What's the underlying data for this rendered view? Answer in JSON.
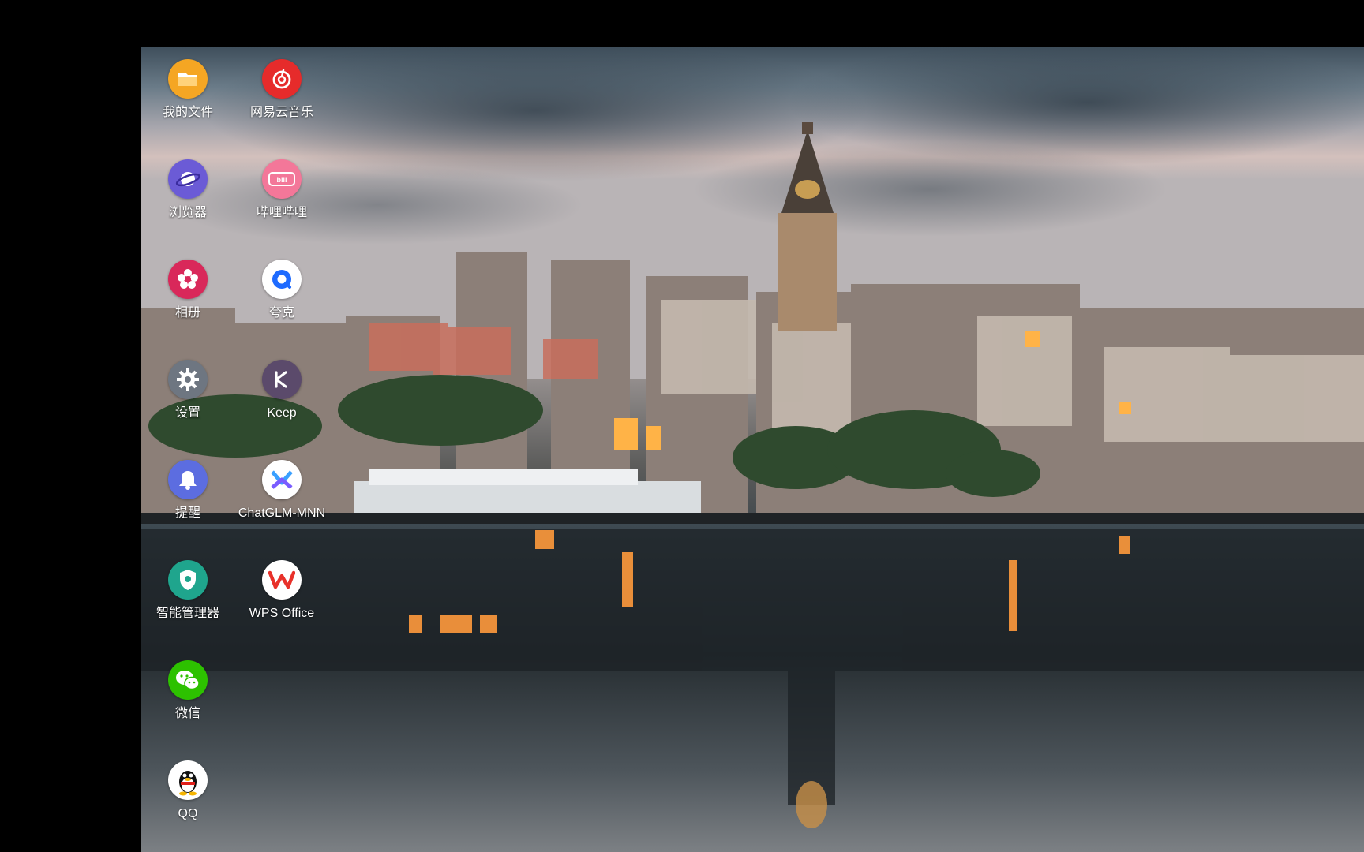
{
  "apps": [
    {
      "key": "myfiles",
      "label": "我的文件",
      "icon": "folder-icon",
      "color": "#f5a623"
    },
    {
      "key": "netease",
      "label": "网易云音乐",
      "icon": "netease-music-icon",
      "color": "#e62b2b"
    },
    {
      "key": "browser",
      "label": "浏览器",
      "icon": "planet-icon",
      "color": "#6b5bd6"
    },
    {
      "key": "bilibili",
      "label": "哔哩哔哩",
      "icon": "bilibili-icon",
      "color": "#f37799"
    },
    {
      "key": "gallery",
      "label": "相册",
      "icon": "flower-icon",
      "color": "#d9285a"
    },
    {
      "key": "quark",
      "label": "夸克",
      "icon": "quark-icon",
      "color": "#ffffff"
    },
    {
      "key": "settings",
      "label": "设置",
      "icon": "gear-icon",
      "color": "#6e7681"
    },
    {
      "key": "keep",
      "label": "Keep",
      "icon": "keep-icon",
      "color": "#5b4a6b"
    },
    {
      "key": "reminder",
      "label": "提醒",
      "icon": "bell-icon",
      "color": "#5c6de0"
    },
    {
      "key": "chatglm",
      "label": "ChatGLM-MNN",
      "icon": "chatglm-icon",
      "color": "#ffffff"
    },
    {
      "key": "manager",
      "label": "智能管理器",
      "icon": "shield-icon",
      "color": "#1fa58d"
    },
    {
      "key": "wps",
      "label": "WPS Office",
      "icon": "wps-icon",
      "color": "#ffffff"
    },
    {
      "key": "wechat",
      "label": "微信",
      "icon": "wechat-icon",
      "color": "#2dc100"
    },
    {
      "key": "qq",
      "label": "QQ",
      "icon": "qq-penguin-icon",
      "color": "#ffffff"
    }
  ]
}
